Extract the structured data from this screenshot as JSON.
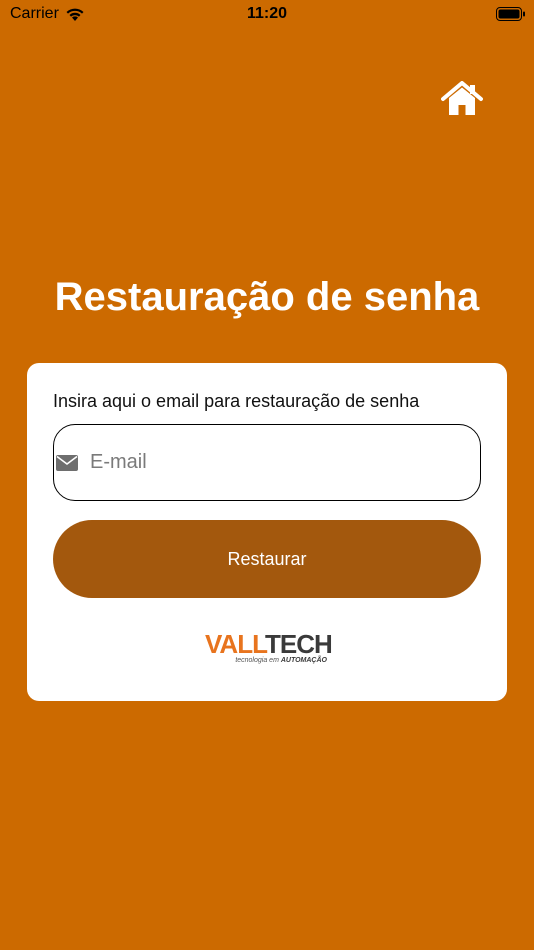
{
  "status_bar": {
    "carrier": "Carrier",
    "time": "11:20"
  },
  "header": {
    "home_icon": "home-icon"
  },
  "page": {
    "title": "Restauração de senha"
  },
  "form": {
    "instruction": "Insira aqui o email para restauração de senha",
    "email_placeholder": "E-mail",
    "email_value": "",
    "email_icon": "envelope-icon",
    "submit_label": "Restaurar"
  },
  "logo": {
    "brand_part1": "VALL",
    "brand_part2": "TECH",
    "tagline_prefix": "tecnologia em ",
    "tagline_emphasis": "AUTOMAÇÃO"
  },
  "colors": {
    "background": "#CC6A00",
    "button": "#A3580D",
    "card": "#FFFFFF",
    "logo_accent": "#E8741E"
  }
}
